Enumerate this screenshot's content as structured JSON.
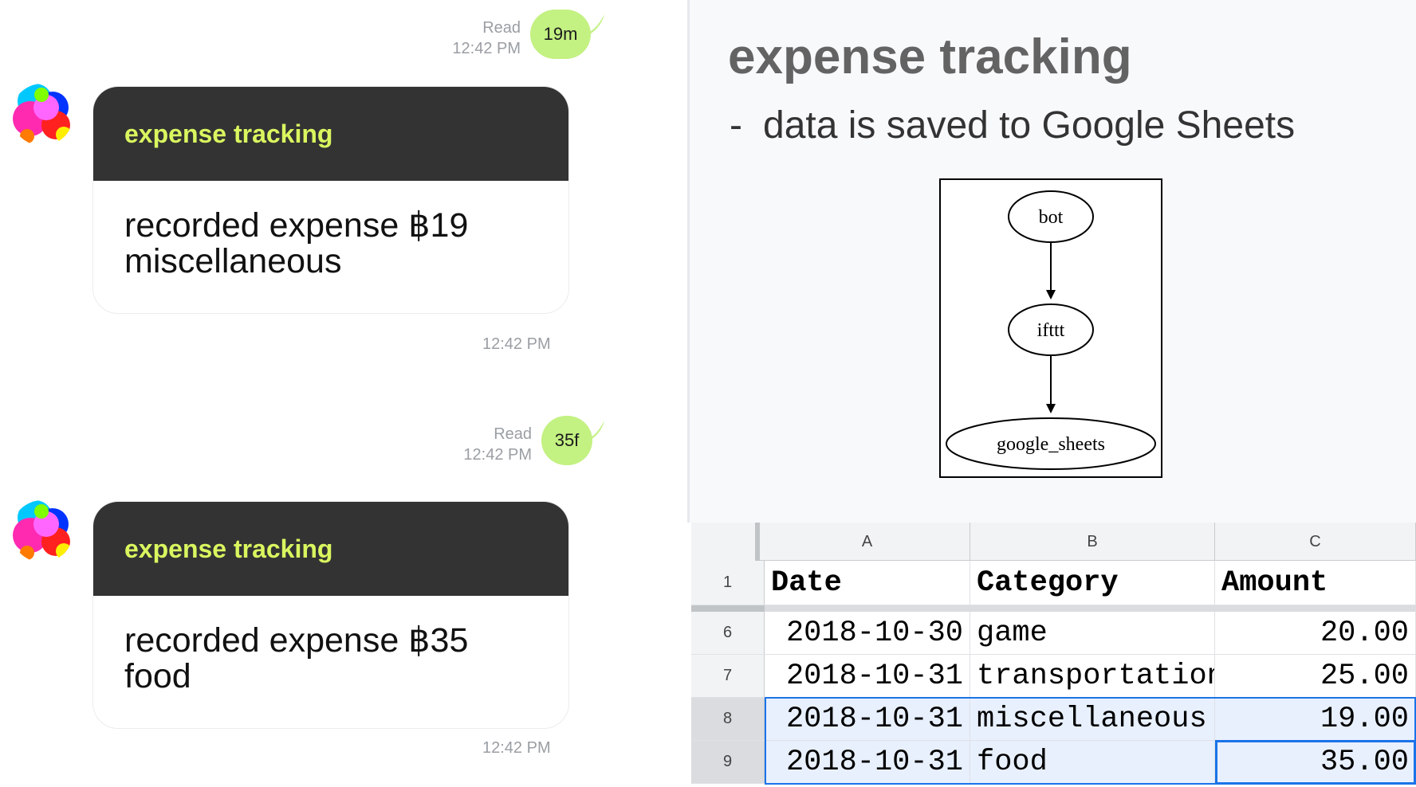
{
  "chat": {
    "messages": [
      {
        "type": "sent",
        "text": "19m",
        "status": "Read",
        "time": "12:42 PM"
      },
      {
        "type": "bot_card",
        "header": "expense tracking",
        "line1": "recorded expense ฿19",
        "line2": "miscellaneous",
        "time": "12:42 PM"
      },
      {
        "type": "sent",
        "text": "35f",
        "status": "Read",
        "time": "12:42 PM"
      },
      {
        "type": "bot_card",
        "header": "expense tracking",
        "line1": "recorded expense ฿35",
        "line2": "food",
        "time": "12:42 PM"
      }
    ]
  },
  "slide": {
    "title": "expense tracking",
    "bullet_marker": "-",
    "bullet": "data is saved to Google Sheets",
    "diagram": {
      "nodes": [
        "bot",
        "ifttt",
        "google_sheets"
      ],
      "edges": [
        [
          "bot",
          "ifttt"
        ],
        [
          "ifttt",
          "google_sheets"
        ]
      ]
    }
  },
  "sheet": {
    "columns": [
      "A",
      "B",
      "C"
    ],
    "header_row": {
      "num": "1",
      "cells": [
        "Date",
        "Category",
        "Amount"
      ]
    },
    "rows": [
      {
        "num": "6",
        "cells": [
          "2018-10-30",
          "game",
          "20.00"
        ]
      },
      {
        "num": "7",
        "cells": [
          "2018-10-31",
          "transportation",
          "25.00"
        ]
      },
      {
        "num": "8",
        "cells": [
          "2018-10-31",
          "miscellaneous",
          "19.00"
        ]
      },
      {
        "num": "9",
        "cells": [
          "2018-10-31",
          "food",
          "35.00"
        ]
      }
    ],
    "selected_rows": [
      "8",
      "9"
    ],
    "active_cell": "C9"
  },
  "colors": {
    "sent_bubble": "#c3f182",
    "card_header_bg": "#333333",
    "card_header_text": "#d9f65f",
    "selection": "#1a73e8"
  }
}
